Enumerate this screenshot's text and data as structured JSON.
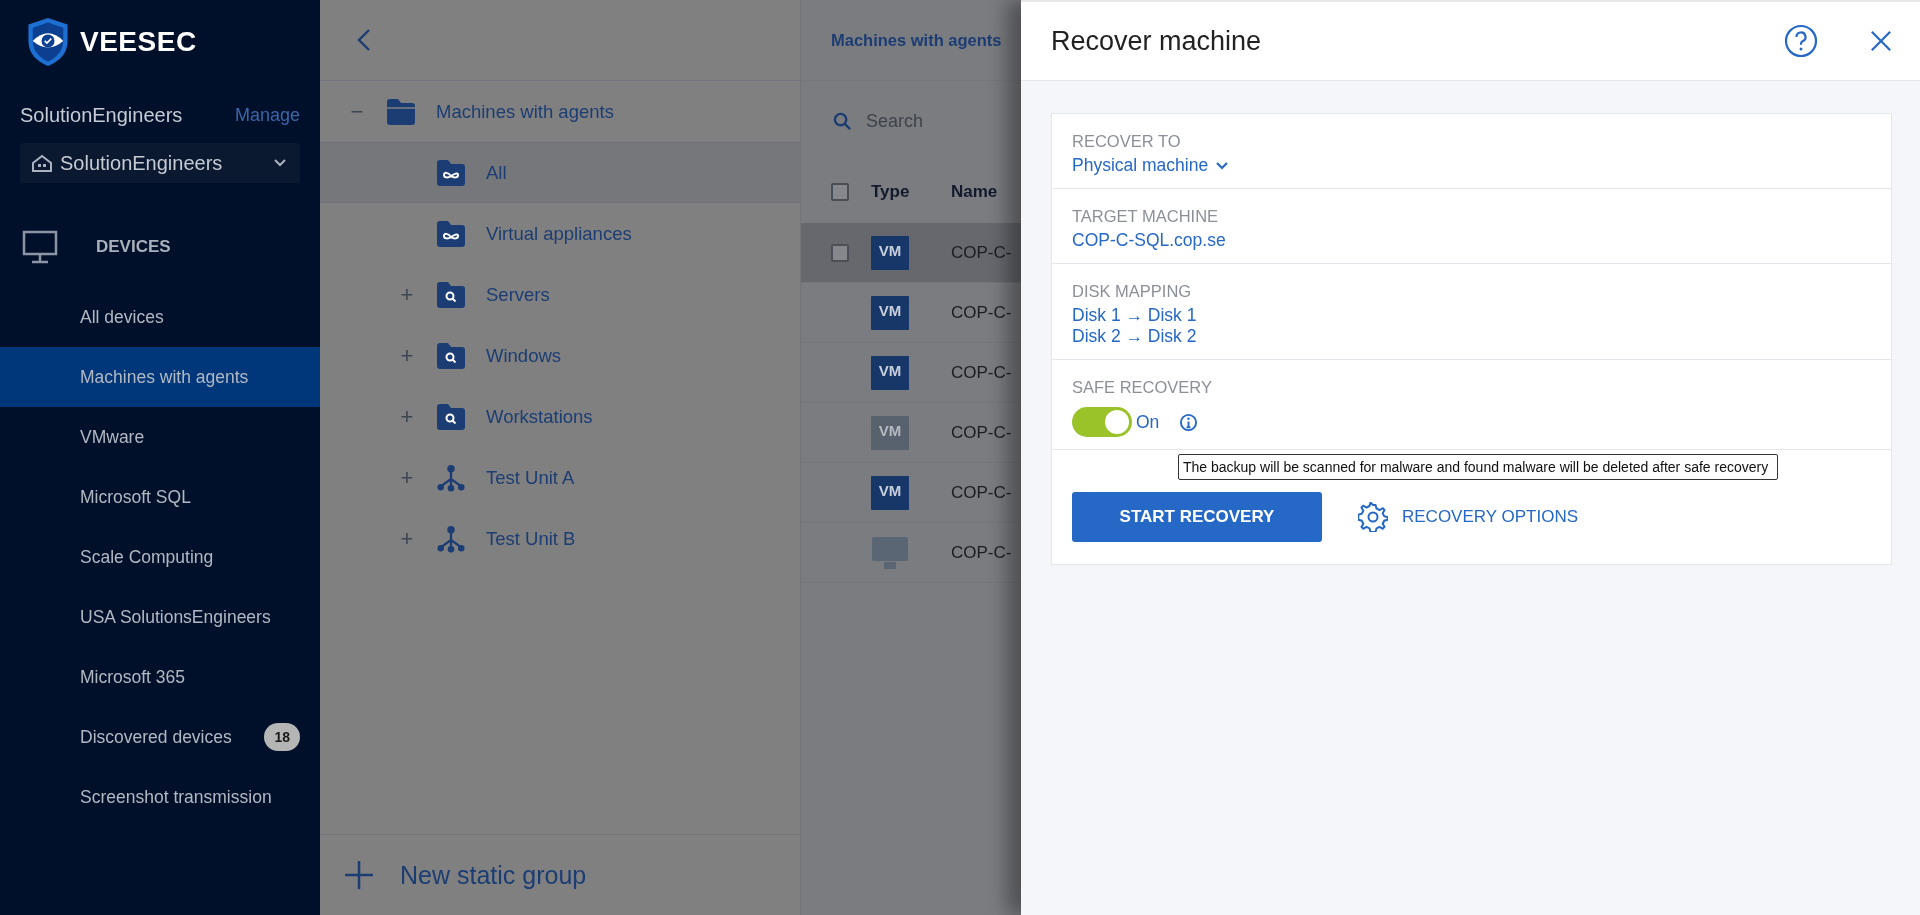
{
  "sidebar": {
    "logo_text": "VEESEC",
    "org_name": "SolutionEngineers",
    "manage_link": "Manage",
    "tenant_selector": "SolutionEngineers",
    "section": "DEVICES",
    "items": [
      {
        "label": "All devices",
        "selected": false
      },
      {
        "label": "Machines with agents",
        "selected": true
      },
      {
        "label": "VMware",
        "selected": false
      },
      {
        "label": "Microsoft SQL",
        "selected": false
      },
      {
        "label": "Scale Computing",
        "selected": false
      },
      {
        "label": "USA SolutionsEngineers",
        "selected": false
      },
      {
        "label": "Microsoft 365",
        "selected": false
      },
      {
        "label": "Discovered devices",
        "selected": false,
        "badge": "18"
      },
      {
        "label": "Screenshot transmission",
        "selected": false
      }
    ]
  },
  "tree": {
    "items": [
      {
        "label": "Machines with agents",
        "kind": "group",
        "toggle": "−",
        "selected": false,
        "children": [
          {
            "label": "All",
            "kind": "builtin",
            "selected": true
          },
          {
            "label": "Virtual appliances",
            "kind": "builtin",
            "selected": false
          },
          {
            "label": "Servers",
            "kind": "dynamic",
            "toggle": "+",
            "selected": false
          },
          {
            "label": "Windows",
            "kind": "dynamic",
            "toggle": "+",
            "selected": false
          },
          {
            "label": "Workstations",
            "kind": "dynamic",
            "toggle": "+",
            "selected": false
          },
          {
            "label": "Test Unit A",
            "kind": "unit",
            "toggle": "+",
            "selected": false
          },
          {
            "label": "Test Unit B",
            "kind": "unit",
            "toggle": "+",
            "selected": false
          }
        ]
      }
    ],
    "new_group": "New static group"
  },
  "list": {
    "title": "Machines with agents",
    "search": {
      "placeholder": "Search"
    },
    "select_all": {
      "checked": false
    },
    "columns": [
      "Type",
      "Name"
    ],
    "rows": [
      {
        "kind": "vm",
        "type_label": "VM",
        "online": true,
        "name": "COP-C-",
        "hovered": true,
        "checked": false
      },
      {
        "kind": "vm",
        "type_label": "VM",
        "online": true,
        "name": "COP-C-",
        "hovered": false
      },
      {
        "kind": "vm",
        "type_label": "VM",
        "online": true,
        "name": "COP-C-",
        "hovered": false
      },
      {
        "kind": "vm",
        "type_label": "VM",
        "online": false,
        "name": "COP-C-",
        "hovered": false
      },
      {
        "kind": "vm",
        "type_label": "VM",
        "online": true,
        "name": "COP-C-",
        "hovered": false
      },
      {
        "kind": "physical",
        "online": false,
        "name": "COP-C-",
        "hovered": false
      }
    ]
  },
  "drawer": {
    "title": "Recover machine",
    "sections": [
      {
        "kind": "dropdown",
        "label": "RECOVER TO",
        "value": "Physical machine"
      },
      {
        "kind": "links",
        "label": "TARGET MACHINE",
        "values": [
          "COP-C-SQL.cop.se"
        ]
      },
      {
        "kind": "links",
        "label": "DISK MAPPING",
        "values": [
          "Disk 1 → Disk 1",
          "Disk 2 → Disk 2"
        ]
      },
      {
        "kind": "toggle",
        "label": "SAFE RECOVERY",
        "on": true,
        "state_text": "On",
        "tooltip": "The backup will be scanned for malware and found malware will be deleted after safe recovery"
      }
    ],
    "primary_button": "START RECOVERY",
    "options_button": "RECOVERY OPTIONS"
  }
}
